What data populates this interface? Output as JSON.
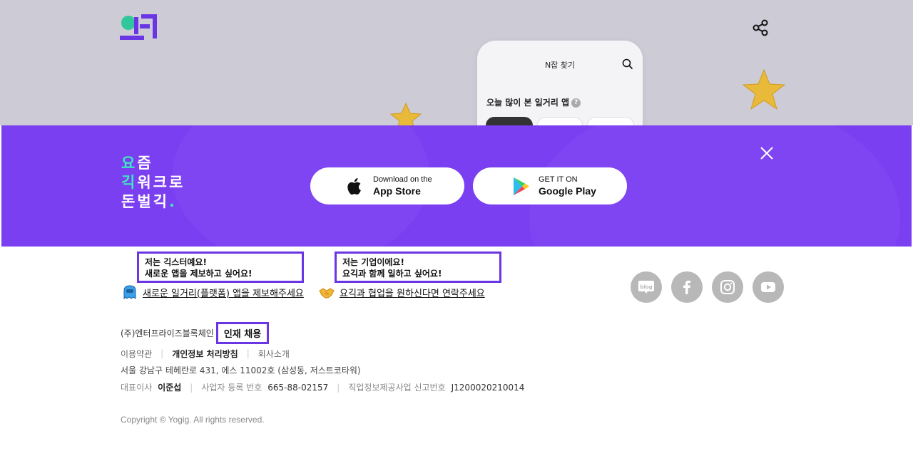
{
  "hero": {
    "phone": {
      "title": "N잡 찾기",
      "heading": "오늘 많이 본 일거리 앱",
      "help_icon": "?"
    }
  },
  "banner": {
    "slogan": {
      "line1": [
        "요",
        "즘"
      ],
      "line2": [
        "긱",
        "워크로"
      ],
      "line3": [
        "돈벌긱",
        "."
      ]
    },
    "app_store": {
      "small": "Download on the",
      "large": "App Store",
      "icon": "apple-icon"
    },
    "google_play": {
      "small": "GET IT ON",
      "large": "Google Play",
      "icon": "google-play-icon"
    }
  },
  "footer": {
    "callout_gigster": {
      "line1": "저는 긱스터예요!",
      "line2": "새로운 앱을 제보하고 싶어요!"
    },
    "callout_company": {
      "line1": "저는 기업이에요!",
      "line2": "요긱과 함께 일하고 싶어요!"
    },
    "link_report": "새로운 일거리(플랫폼) 앱을 제보해주세요",
    "link_partner": "요긱과 협업을 원하신다면 연락주세요",
    "social": [
      "blog-icon",
      "facebook-icon",
      "instagram-icon",
      "youtube-icon"
    ],
    "blog_label": "blog",
    "company_name": "(주)엔터프라이즈블록체인",
    "recruit": "인재 채용",
    "links": {
      "terms": "이용약관",
      "privacy": "개인정보 처리방침",
      "about": "회사소개"
    },
    "address": "서울 강남구 테헤란로 431, 에스 11002호 (삼성동, 저스트코타워)",
    "ceo_label": "대표이사",
    "ceo_name": "이준섭",
    "biz_label": "사업자 등록 번호",
    "biz_no": "665-88-02157",
    "job_label": "직업정보제공사업 신고번호",
    "job_no": "J1200020210014",
    "copyright": "Copyright © Yogig. All rights reserved."
  },
  "colors": {
    "brand_purple": "#7b3ff2",
    "accent_mint": "#3ee6c2",
    "hero_bg": "#cdcbd6"
  }
}
